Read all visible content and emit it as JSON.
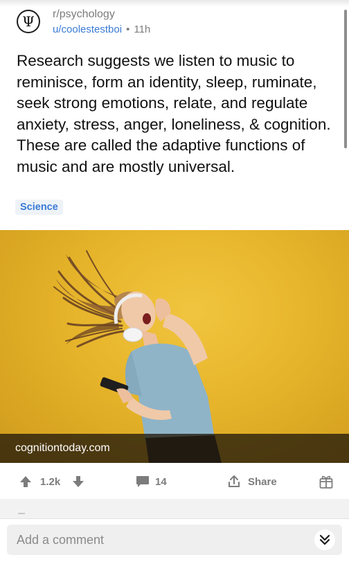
{
  "post": {
    "subreddit": "r/psychology",
    "author": "u/coolestestboi",
    "separator": "•",
    "age": "11h",
    "title": "Research suggests we listen to music to reminisce, form an identity, sleep, ruminate, seek strong emotions, relate, and regulate anxiety, stress, anger, loneliness, & cognition. These are called the adaptive functions of music and are mostly universal.",
    "flair": "Science",
    "link_domain": "cognitiontoday.com",
    "subreddit_icon": "psi-icon"
  },
  "actions": {
    "score": "1.2k",
    "comments": "14",
    "share_label": "Share"
  },
  "comment": {
    "placeholder": "Add a comment"
  },
  "colors": {
    "link_blue": "#3a7bd5",
    "muted_gray": "#7c7c7c",
    "image_yellow": "#e6b42a"
  }
}
